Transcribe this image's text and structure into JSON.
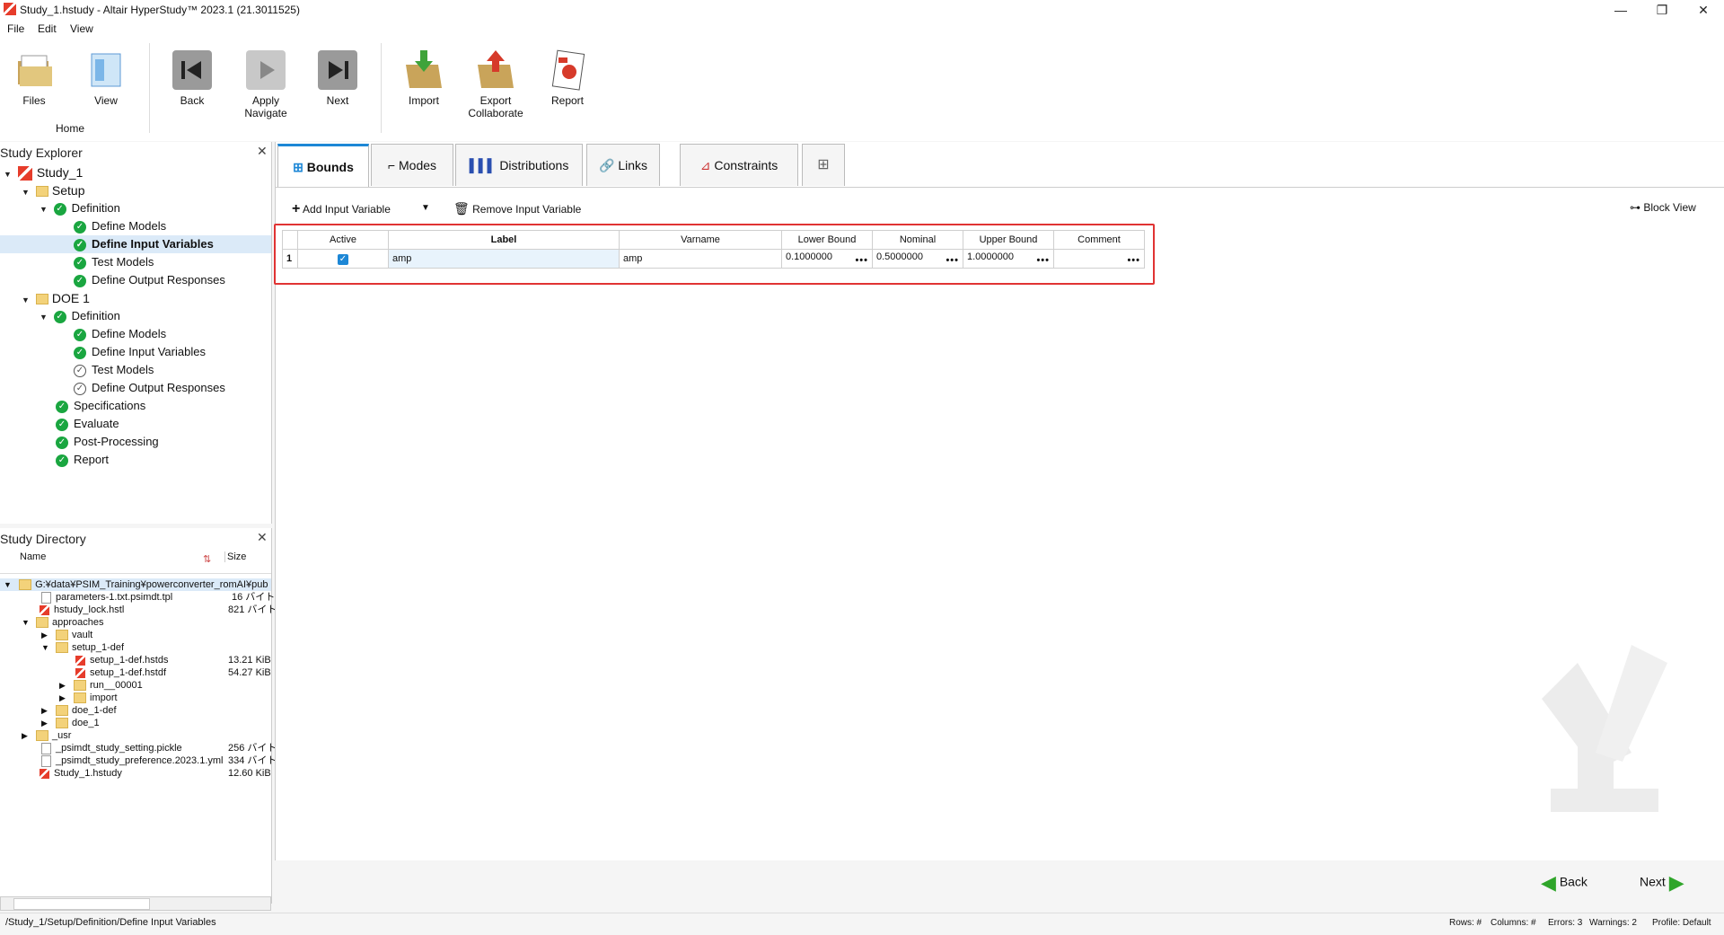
{
  "window": {
    "title": "Study_1.hstudy - Altair HyperStudy™ 2023.1 (21.3011525)",
    "minimize": "—",
    "restore": "❐",
    "close": "✕"
  },
  "menu": [
    "File",
    "Edit",
    "View"
  ],
  "toolbar": {
    "files": "Files",
    "view": "View",
    "home": "Home",
    "back": "Back",
    "apply_navigate_1": "Apply",
    "apply_navigate_2": "Navigate",
    "next": "Next",
    "import": "Import",
    "export_1": "Export",
    "export_2": "Collaborate",
    "report": "Report"
  },
  "explorer": {
    "title": "Study Explorer",
    "items": [
      {
        "label": "Study_1"
      },
      {
        "label": "Setup"
      },
      {
        "label": "Definition"
      },
      {
        "label": "Define Models"
      },
      {
        "label": "Define Input Variables"
      },
      {
        "label": "Test Models"
      },
      {
        "label": "Define Output Responses"
      },
      {
        "label": "DOE 1"
      },
      {
        "label": "Definition"
      },
      {
        "label": "Define Models"
      },
      {
        "label": "Define Input Variables"
      },
      {
        "label": "Test Models"
      },
      {
        "label": "Define Output Responses"
      },
      {
        "label": "Specifications"
      },
      {
        "label": "Evaluate"
      },
      {
        "label": "Post-Processing"
      },
      {
        "label": "Report"
      }
    ]
  },
  "directory": {
    "title": "Study Directory",
    "col_name": "Name",
    "col_size": "Size",
    "rows": [
      {
        "name": "G:¥data¥PSIM_Training¥powerconverter_romAI¥pub",
        "size": ""
      },
      {
        "name": "parameters-1.txt.psimdt.tpl",
        "size": "16 バイト"
      },
      {
        "name": "hstudy_lock.hstl",
        "size": "821 バイト"
      },
      {
        "name": "approaches",
        "size": ""
      },
      {
        "name": "vault",
        "size": ""
      },
      {
        "name": "setup_1-def",
        "size": ""
      },
      {
        "name": "setup_1-def.hstds",
        "size": "13.21 KiB"
      },
      {
        "name": "setup_1-def.hstdf",
        "size": "54.27 KiB"
      },
      {
        "name": "run__00001",
        "size": ""
      },
      {
        "name": "import",
        "size": ""
      },
      {
        "name": "doe_1-def",
        "size": ""
      },
      {
        "name": "doe_1",
        "size": ""
      },
      {
        "name": "_usr",
        "size": ""
      },
      {
        "name": "_psimdt_study_setting.pickle",
        "size": "256 バイト"
      },
      {
        "name": "_psimdt_study_preference.2023.1.yml",
        "size": "334 バイト"
      },
      {
        "name": "Study_1.hstudy",
        "size": "12.60 KiB"
      }
    ]
  },
  "tabs": [
    "Bounds",
    "Modes",
    "Distributions",
    "Links",
    "Constraints"
  ],
  "actions": {
    "add": "Add Input Variable",
    "remove": "Remove Input Variable",
    "block_view": "Block View"
  },
  "grid": {
    "headers": [
      "Active",
      "Label",
      "Varname",
      "Lower Bound",
      "Nominal",
      "Upper Bound",
      "Comment"
    ],
    "row": {
      "index": "1",
      "label": "amp",
      "varname": "amp",
      "lower": "0.1000000",
      "nominal": "0.5000000",
      "upper": "1.0000000",
      "comment": ""
    }
  },
  "nav": {
    "back": "Back",
    "next": "Next"
  },
  "status": {
    "path": "/Study_1/Setup/Definition/Define Input Variables",
    "rows": "Rows: #",
    "columns": "Columns: #",
    "errors": "Errors: 3",
    "warnings": "Warnings: 2",
    "profile": "Profile: Default"
  },
  "colors": {
    "accent": "#1d87d6",
    "ok": "#1aa640",
    "highlight": "#e03333"
  }
}
